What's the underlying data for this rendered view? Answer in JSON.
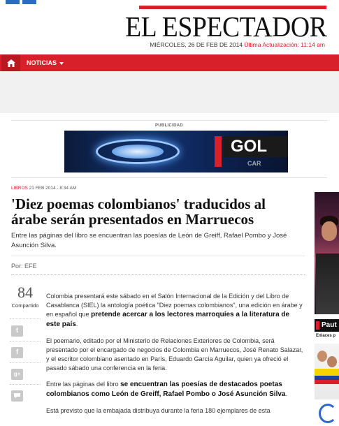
{
  "masthead": {
    "logo": "EL ESPECTADOR",
    "date": "MIÉRCOLES, 26 DE FEB DE 2014",
    "update": "Última Actualización: 11:14 am"
  },
  "nav": {
    "home_icon": "home-icon",
    "noticias_label": "NOTICIAS"
  },
  "ad": {
    "label": "PUBLICIDAD",
    "banner_brand": "GOL",
    "banner_sub": "CAR"
  },
  "article": {
    "section": "LIBROS",
    "timestamp": "21 FEB 2014 - 8:34 AM",
    "headline": "'Diez poemas colombianos' traducidos al árabe serán presentados en Marruecos",
    "summary": "Entre las páginas del libro se encuentran las poesías de León de Greiff, Rafael Pombo y José Asunción Silva.",
    "byline": "Por: EFE",
    "share_count": "84",
    "share_label": "Compartido",
    "paragraphs": {
      "p1_a": "Colombia presentará este sábado en el Salón Internacional de la Edición y del Libro de Casablanca (SIEL) la antología poética \"Diez poemas colombianos\", una edición en árabe y en español que ",
      "p1_b": "pretende acercar a los lectores marroquíes a la literatura de este país",
      "p1_c": ".",
      "p2": "El poemario, editado por el Ministerio de Relaciones Exteriores de Colombia, será presentado por el encargado de negocios de Colombia en Marruecos, José Renato Salazar, y el escritor colombiano asentado en París, Eduardo García Aguilar, quien ya ofreció el pasado sábado una conferencia en la feria.",
      "p3_a": "Entre las páginas del libro ",
      "p3_b": "se encuentran las poesías de destacados poetas colombianos como León de Greiff, Rafael Pombo o José Asunción Silva",
      "p3_c": ".",
      "p4": "Está previsto que la embajada distribuya durante la feria 180 ejemplares de esta"
    }
  },
  "share_icons": [
    "twitter-icon",
    "facebook-icon",
    "google-plus-icon",
    "comment-icon"
  ],
  "right_column": {
    "bar_text": "Paut",
    "caption": "Enlaces p"
  },
  "colors": {
    "brand_red": "#d8202a",
    "nav_home_bg": "#b81820"
  }
}
